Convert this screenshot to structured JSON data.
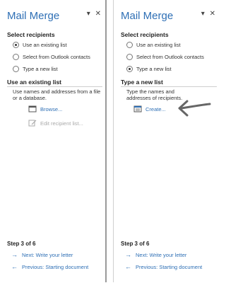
{
  "panes": [
    {
      "title": "Mail Merge",
      "pin_glyph": "▾",
      "close_glyph": "✕",
      "select_heading": "Select recipients",
      "options": [
        {
          "label": "Use an existing list",
          "checked": true
        },
        {
          "label": "Select from Outlook contacts",
          "checked": false
        },
        {
          "label": "Type a new list",
          "checked": false
        }
      ],
      "section_heading": "Use an existing list",
      "section_desc": "Use names and addresses from a file or a database.",
      "actions": [
        {
          "label": "Browse...",
          "icon": "folder-document-icon",
          "enabled": true
        },
        {
          "label": "Edit recipient list...",
          "icon": "edit-document-icon",
          "enabled": false
        }
      ],
      "step": "Step 3 of 6",
      "next": "Next: Write your letter",
      "previous": "Previous: Starting document"
    },
    {
      "title": "Mail Merge",
      "pin_glyph": "▾",
      "close_glyph": "✕",
      "select_heading": "Select recipients",
      "options": [
        {
          "label": "Use an existing list",
          "checked": false
        },
        {
          "label": "Select from Outlook contacts",
          "checked": false
        },
        {
          "label": "Type a new list",
          "checked": true
        }
      ],
      "section_heading": "Type a new list",
      "section_desc": "Type the names and addresses of recipients.",
      "actions": [
        {
          "label": "Create...",
          "icon": "create-list-icon",
          "enabled": true
        }
      ],
      "step": "Step 3 of 6",
      "next": "Next: Write your letter",
      "previous": "Previous: Starting document"
    }
  ],
  "colors": {
    "title": "#2e6fb5",
    "link": "#2e6fb5",
    "annotation_arrow": "#666666"
  }
}
